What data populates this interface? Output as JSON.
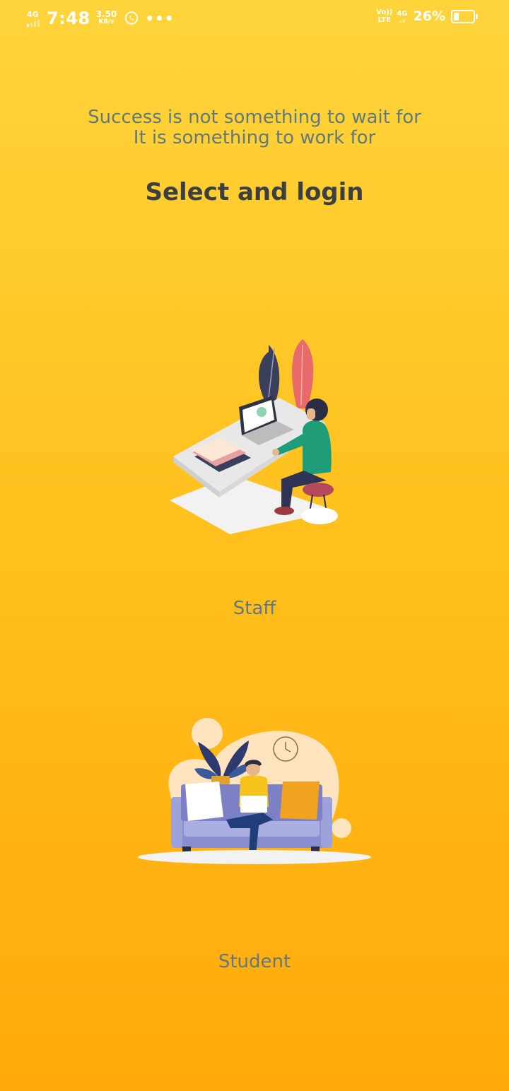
{
  "status_bar": {
    "network_left": "4G",
    "time": "7:48",
    "speed_value": "3.50",
    "speed_unit": "KB/s",
    "more": "•••",
    "volte_top": "Vo))",
    "volte_bottom": "LTE",
    "network_right": "4G",
    "battery_percent": "26%",
    "battery_level": 0.26
  },
  "header": {
    "quote_line1": "Success is not something to wait for",
    "quote_line2": "It is something to work for",
    "title": "Select and login"
  },
  "options": [
    {
      "label": "Staff",
      "illustration": "staff-desk-illustration"
    },
    {
      "label": "Student",
      "illustration": "student-sofa-illustration"
    }
  ],
  "colors": {
    "background_top": "#FFD43B",
    "background_bottom": "#FFA90A",
    "quote_text": "#5F7A7D",
    "title_text": "#3A3F3F"
  }
}
